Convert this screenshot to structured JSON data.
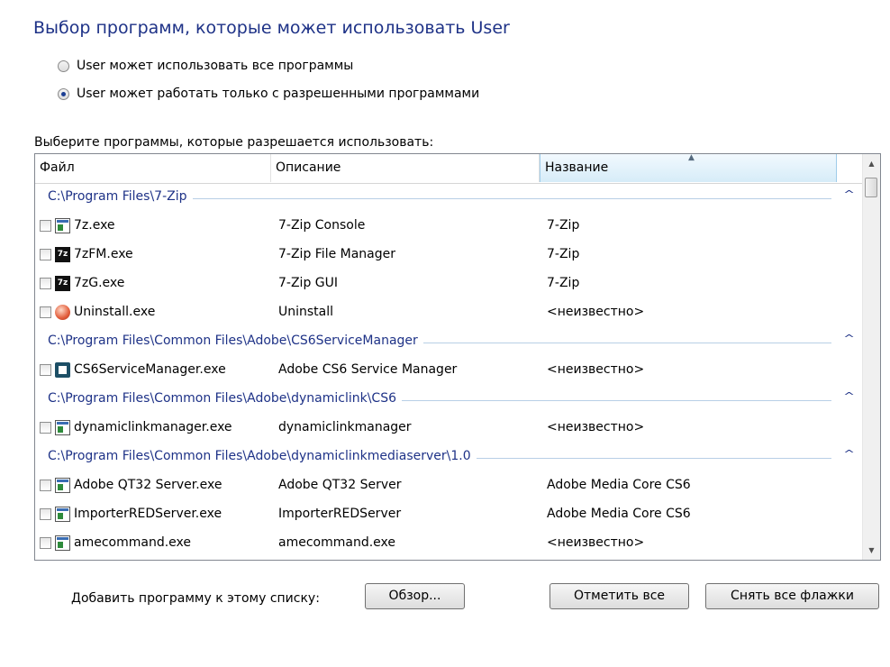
{
  "page": {
    "title": "Выбор программ, которые может использовать User"
  },
  "options": [
    {
      "label": "User может использовать все программы",
      "checked": false
    },
    {
      "label": "User может работать только с разрешенными программами",
      "checked": true
    }
  ],
  "list": {
    "caption": "Выберите программы, которые разрешается использовать:",
    "columns": [
      "Файл",
      "Описание",
      "Название"
    ],
    "sorted_column": "Название",
    "groups": [
      {
        "path": "C:\\Program Files\\7-Zip",
        "rows": [
          {
            "icon": "exe-icon",
            "file": "7z.exe",
            "description": "7-Zip Console",
            "name": "7-Zip"
          },
          {
            "icon": "7zip-icon",
            "file": "7zFM.exe",
            "description": "7-Zip File Manager",
            "name": "7-Zip"
          },
          {
            "icon": "7zip-icon",
            "file": "7zG.exe",
            "description": "7-Zip GUI",
            "name": "7-Zip"
          },
          {
            "icon": "uninstall-icon",
            "file": "Uninstall.exe",
            "description": "Uninstall",
            "name": "<неизвестно>"
          }
        ]
      },
      {
        "path": "C:\\Program Files\\Common Files\\Adobe\\CS6ServiceManager",
        "rows": [
          {
            "icon": "cs6-service-icon",
            "file": "CS6ServiceManager.exe",
            "description": "Adobe CS6 Service Manager",
            "name": "<неизвестно>"
          }
        ]
      },
      {
        "path": "C:\\Program Files\\Common Files\\Adobe\\dynamiclink\\CS6",
        "rows": [
          {
            "icon": "exe-icon",
            "file": "dynamiclinkmanager.exe",
            "description": "dynamiclinkmanager",
            "name": "<неизвестно>"
          }
        ]
      },
      {
        "path": "C:\\Program Files\\Common Files\\Adobe\\dynamiclinkmediaserver\\1.0",
        "rows": [
          {
            "icon": "exe-icon",
            "file": "Adobe QT32 Server.exe",
            "description": "Adobe QT32 Server",
            "name": "Adobe Media Core CS6"
          },
          {
            "icon": "exe-icon",
            "file": "ImporterREDServer.exe",
            "description": "ImporterREDServer",
            "name": "Adobe Media Core CS6"
          },
          {
            "icon": "exe-icon",
            "file": "amecommand.exe",
            "description": "amecommand.exe",
            "name": "<неизвестно>"
          }
        ]
      }
    ]
  },
  "bottom": {
    "add_label": "Добавить программу к этому списку:",
    "browse_button": "Обзор...",
    "check_all_button": "Отметить все",
    "uncheck_all_button": "Снять все флажки"
  },
  "colors": {
    "accent": "#1e3287",
    "group_line": "#b8cfe6",
    "sorted_header": "#d6ecf8"
  }
}
